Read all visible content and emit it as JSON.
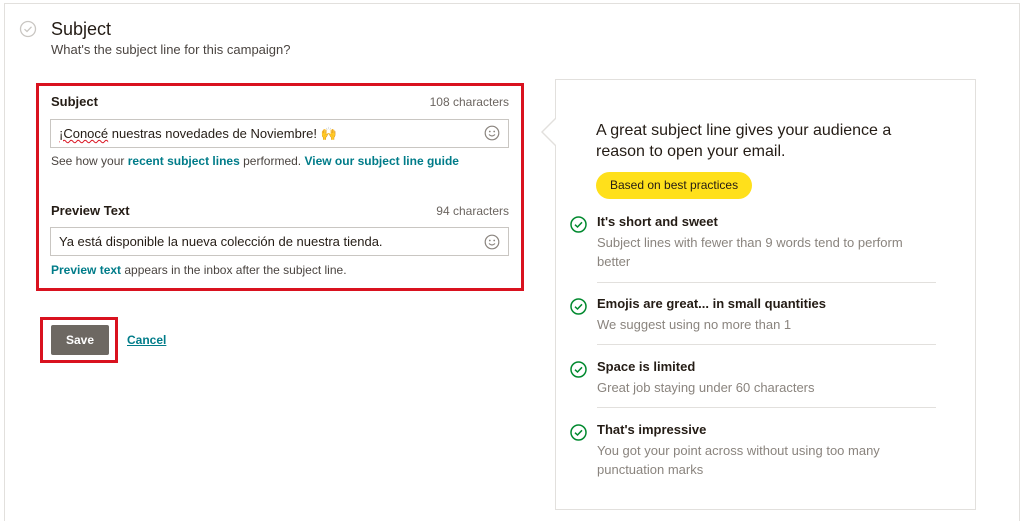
{
  "step": {
    "title": "Subject",
    "subtitle": "What's the subject line for this campaign?"
  },
  "subject": {
    "label": "Subject",
    "char_count": "108 characters",
    "value_misspelled": "¡Conocé",
    "value_rest": " nuestras novedades de Noviembre! 🙌",
    "help_prefix": "See how your ",
    "help_link1": "recent subject lines",
    "help_middle": " performed. ",
    "help_link2": "View our subject line guide"
  },
  "preview": {
    "label": "Preview Text",
    "char_count": "94 characters",
    "value": "Ya está disponible la nueva colección de nuestra tienda.",
    "help_link": "Preview text",
    "help_rest": " appears in the inbox after the subject line."
  },
  "actions": {
    "save_label": "Save",
    "cancel_label": "Cancel"
  },
  "tips": {
    "headline": "A great subject line gives your audience a reason to open your email.",
    "badge": "Based on best practices",
    "items": [
      {
        "title": "It's short and sweet",
        "desc": "Subject lines with fewer than 9 words tend to perform better"
      },
      {
        "title": "Emojis are great... in small quantities",
        "desc": "We suggest using no more than 1"
      },
      {
        "title": "Space is limited",
        "desc": "Great job staying under 60 characters"
      },
      {
        "title": "That's impressive",
        "desc": "You got your point across without using too many punctuation marks"
      }
    ]
  },
  "colors": {
    "accent_link": "#007c89",
    "success_green": "#00892e",
    "highlight_red": "#d9121f",
    "badge_yellow": "#ffe01b",
    "save_button": "#6d6862"
  },
  "icons": {
    "step_status": "check-circle-icon",
    "emoji_picker": "smiley-icon",
    "tip_status": "check-circle-icon"
  }
}
